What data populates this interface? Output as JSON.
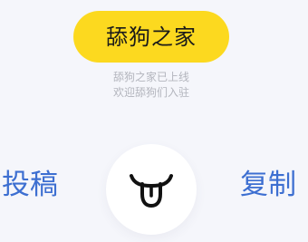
{
  "header": {
    "title": "舔狗之家",
    "subtitle_line1": "舔狗之家已上线",
    "subtitle_line2": "欢迎舔狗们入驻"
  },
  "actions": {
    "submit_label": "投稿",
    "copy_label": "复制",
    "center_icon": "tongue-face-icon"
  },
  "colors": {
    "background": "#f5f6fb",
    "accent_yellow": "#fcd91f",
    "link_blue": "#3d6fd1",
    "muted_text": "#b3b5bd"
  }
}
